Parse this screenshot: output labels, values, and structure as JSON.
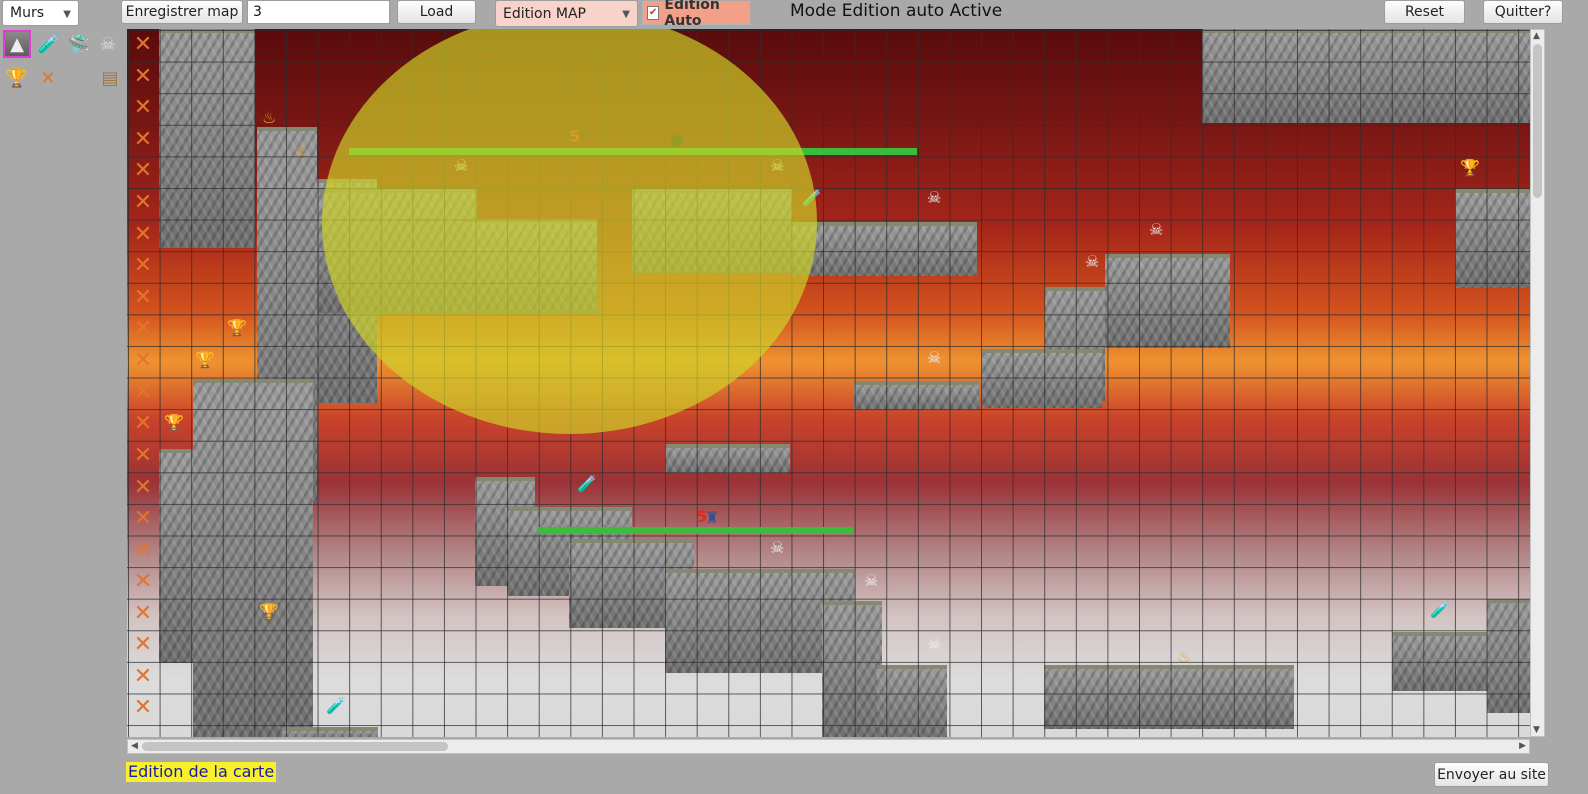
{
  "toolbar": {
    "layer_select": "Murs",
    "save_button": "Enregistrer map",
    "map_number": "3",
    "load_button": "Load",
    "mode_select": "Edition MAP",
    "auto_edit_checkbox": "Edition Auto",
    "status_text": "Mode Edition auto Active",
    "reset_button": "Reset",
    "quit_button": "Quitter?"
  },
  "map": {
    "enemy_count_badges": [
      "5",
      "5"
    ]
  },
  "footer": {
    "mode_label": "Edition de la carte",
    "send_button": "Envoyer au site"
  },
  "colors": {
    "accent_orange": "#e2742c",
    "checkbox_highlight": "#f2a088",
    "footer_label_bg": "#f7f02a",
    "progress_green": "#3dbb3a"
  }
}
